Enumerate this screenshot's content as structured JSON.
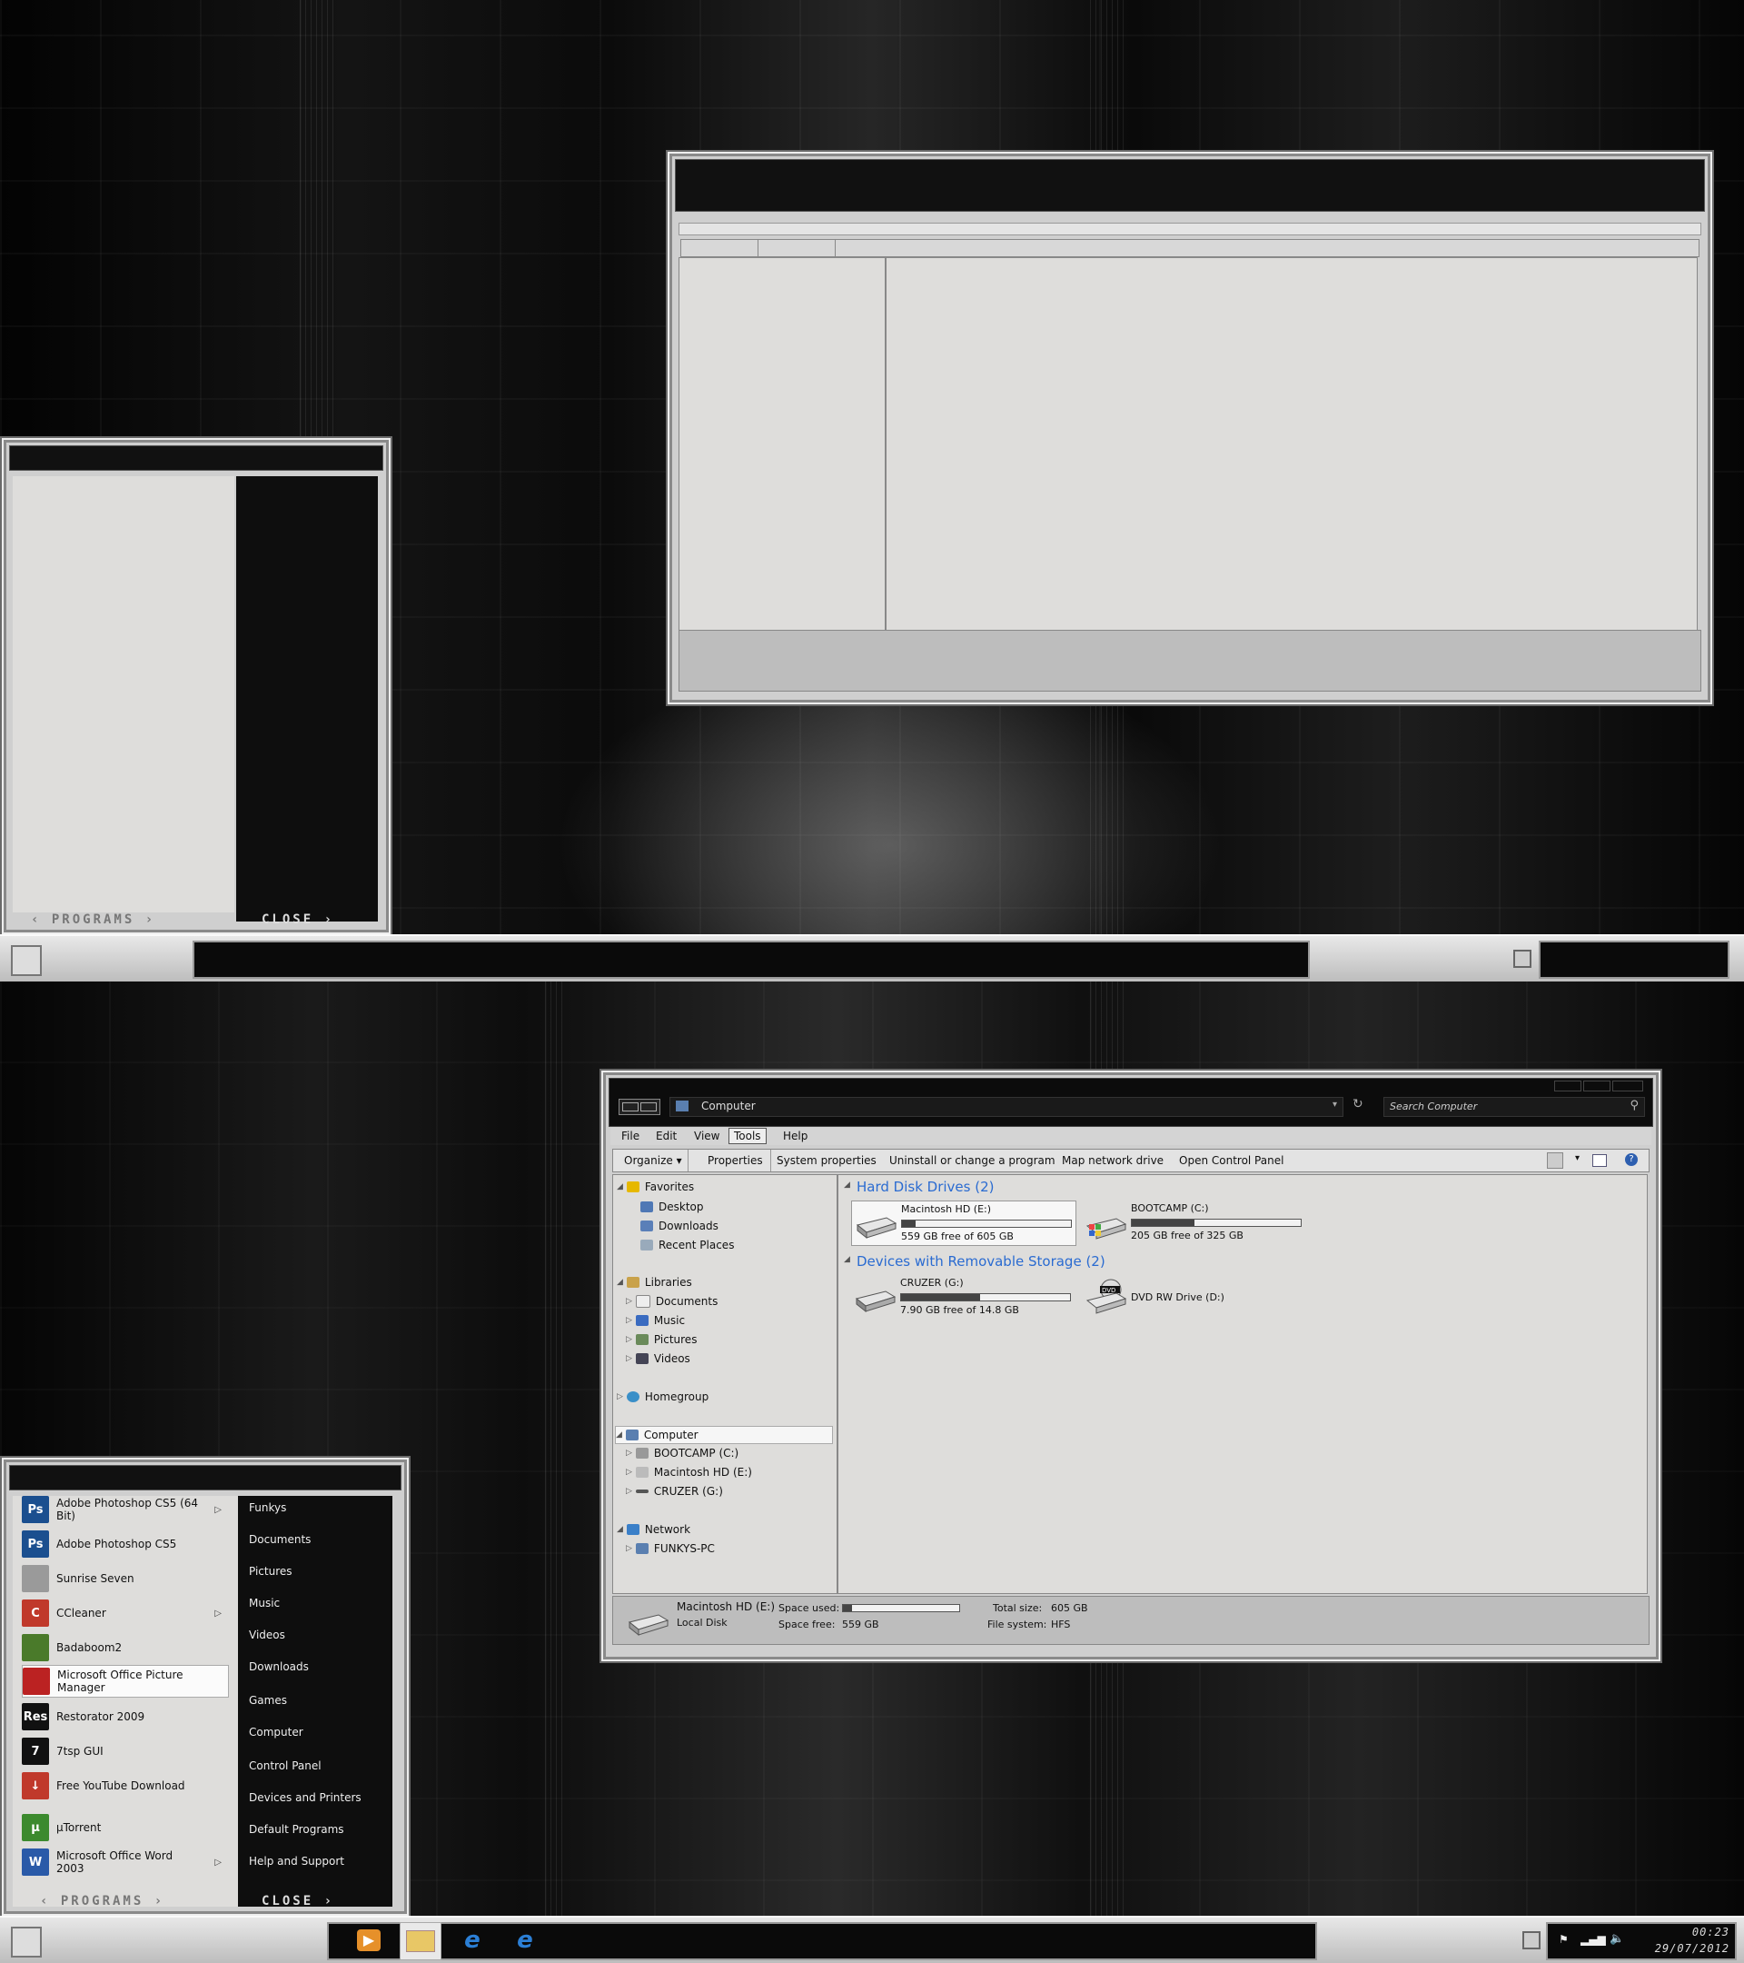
{
  "top": {
    "start_menu": {
      "programs_label": "‹ PROGRAMS ›",
      "close_label": "CLOSE ›"
    },
    "taskbar": {}
  },
  "bottom": {
    "explorer": {
      "address": "Computer",
      "search_placeholder": "Search Computer",
      "menu": [
        "File",
        "Edit",
        "View",
        "Tools",
        "Help"
      ],
      "active_menu": "Tools",
      "commands": [
        "Organize ▾",
        "Properties",
        "System properties",
        "Uninstall or change a program",
        "Map network drive",
        "Open Control Panel"
      ],
      "nav": {
        "favorites": "Favorites",
        "favorites_items": [
          "Desktop",
          "Downloads",
          "Recent Places"
        ],
        "libraries": "Libraries",
        "libraries_items": [
          "Documents",
          "Music",
          "Pictures",
          "Videos"
        ],
        "homegroup": "Homegroup",
        "computer": "Computer",
        "computer_items": [
          "BOOTCAMP (C:)",
          "Macintosh HD (E:)",
          "CRUZER (G:)"
        ],
        "network": "Network",
        "network_items": [
          "FUNKYS-PC"
        ]
      },
      "groups": {
        "hdd": "Hard Disk Drives (2)",
        "removable": "Devices with Removable Storage (2)"
      },
      "drives": [
        {
          "name": "Macintosh HD (E:)",
          "free": "559 GB free of 605 GB",
          "used_fraction": 0.08
        },
        {
          "name": "BOOTCAMP (C:)",
          "free": "205 GB free of 325 GB",
          "used_fraction": 0.37
        },
        {
          "name": "CRUZER (G:)",
          "free": "7.90 GB free of 14.8 GB",
          "used_fraction": 0.47
        },
        {
          "name": "DVD RW Drive (D:)",
          "free": ""
        }
      ],
      "details": {
        "name": "Macintosh HD (E:)",
        "type": "Local Disk",
        "space_used_label": "Space used:",
        "space_free_label": "Space free:",
        "space_free": "559 GB",
        "total_size_label": "Total size:",
        "total_size": "605 GB",
        "filesystem_label": "File system:",
        "filesystem": "HFS",
        "used_fraction": 0.08
      }
    },
    "start_menu": {
      "programs": [
        {
          "label": "Adobe Photoshop CS5 (64 Bit)",
          "icon": "photoshop-icon",
          "abbr": "Ps",
          "color": "#1b4f8f",
          "arrow": true
        },
        {
          "label": "Adobe Photoshop CS5",
          "icon": "photoshop-icon",
          "abbr": "Ps",
          "color": "#1b4f8f",
          "arrow": false
        },
        {
          "label": "Sunrise Seven",
          "icon": "sunrise-seven-icon",
          "abbr": "",
          "color": "#9a9a9a",
          "arrow": false
        },
        {
          "label": "CCleaner",
          "icon": "ccleaner-icon",
          "abbr": "C",
          "color": "#c0392b",
          "arrow": true
        },
        {
          "label": "Badaboom2",
          "icon": "badaboom-icon",
          "abbr": "",
          "color": "#4a7a2a",
          "arrow": false
        },
        {
          "label": "Microsoft Office Picture Manager",
          "icon": "picture-manager-icon",
          "abbr": "",
          "color": "#b22",
          "arrow": false
        },
        {
          "label": "Restorator 2009",
          "icon": "restorator-icon",
          "abbr": "Res",
          "color": "#111",
          "arrow": false
        },
        {
          "label": "7tsp GUI",
          "icon": "7tsp-icon",
          "abbr": "7",
          "color": "#111",
          "arrow": false
        },
        {
          "label": "Free YouTube Download",
          "icon": "youtube-download-icon",
          "abbr": "↓",
          "color": "#c0392b",
          "arrow": false
        },
        {
          "label": "µTorrent",
          "icon": "utorrent-icon",
          "abbr": "µ",
          "color": "#3c8a2e",
          "arrow": false
        },
        {
          "label": "Microsoft Office Word 2003",
          "icon": "word-icon",
          "abbr": "W",
          "color": "#2a5aa8",
          "arrow": true
        }
      ],
      "right_items": [
        "Funkys",
        "Documents",
        "Pictures",
        "Music",
        "Videos",
        "Downloads",
        "Games",
        "Computer",
        "Control Panel",
        "Devices and Printers",
        "Default Programs",
        "Help and Support"
      ],
      "programs_label": "‹ PROGRAMS ›",
      "close_label": "CLOSE ›"
    },
    "taskbar": {
      "time": "00:23",
      "date": "29/07/2012"
    }
  }
}
